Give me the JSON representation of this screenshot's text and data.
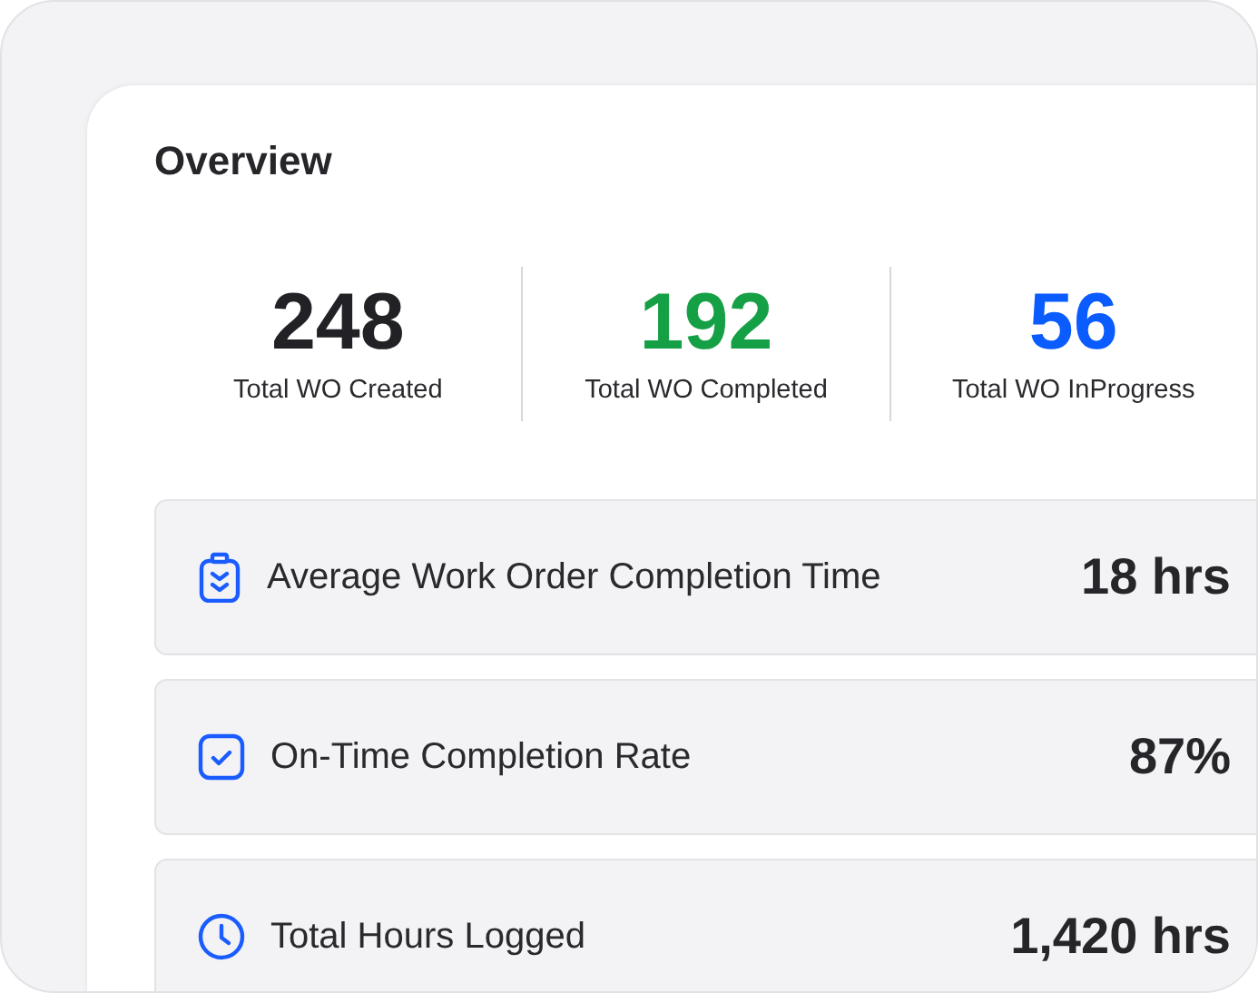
{
  "title": "Overview",
  "stats": [
    {
      "value": "248",
      "label": "Total WO Created",
      "color": "#222226"
    },
    {
      "value": "192",
      "label": "Total WO Completed",
      "color": "#16a046"
    },
    {
      "value": "56",
      "label": "Total WO InProgress",
      "color": "#0a5cff"
    }
  ],
  "metrics": [
    {
      "label": "Average Work Order Completion Time",
      "value": "18 hrs"
    },
    {
      "label": "On-Time Completion Rate",
      "value": "87%"
    },
    {
      "label": "Total Hours Logged",
      "value": "1,420 hrs"
    }
  ]
}
